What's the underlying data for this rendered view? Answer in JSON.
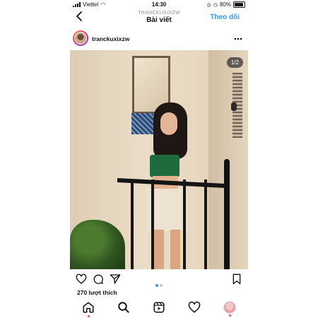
{
  "status_bar": {
    "carrier": "Viettel",
    "time": "14:30",
    "battery": "80%"
  },
  "header": {
    "back_icon": "chevron-left-icon",
    "subtitle": "TRANCKUXIXZW",
    "title": "Bài viết",
    "follow_label": "Theo dõi"
  },
  "post": {
    "username": "tranckuxixzw",
    "more_icon": "more-icon",
    "image_counter": "1/2",
    "likes": "270 lượt thích",
    "current_image": 1,
    "total_images": 2
  },
  "actions": {
    "like_icon": "heart-icon",
    "comment_icon": "comment-icon",
    "share_icon": "send-icon",
    "save_icon": "bookmark-icon"
  },
  "tabbar": {
    "items": [
      "home-icon",
      "search-icon",
      "reels-icon",
      "activity-icon",
      "profile-icon"
    ]
  },
  "colors": {
    "accent": "#3897f0",
    "notification": "#ed4956"
  }
}
